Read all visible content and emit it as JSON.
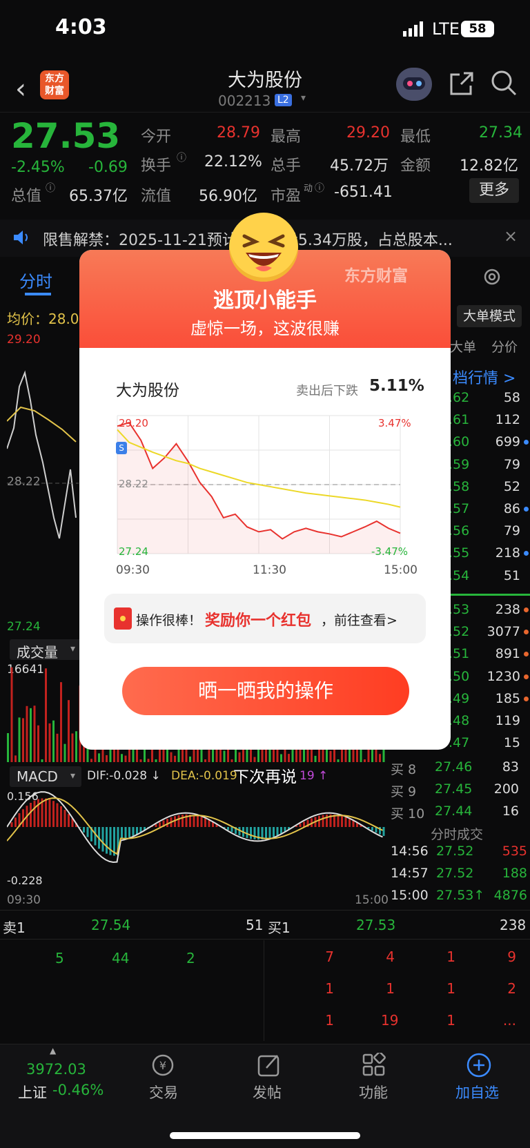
{
  "status_bar": {
    "time": "4:03",
    "network": "LTE",
    "battery": "58"
  },
  "header": {
    "title": "大为股份",
    "code": "002213",
    "level": "L2",
    "logo": "东方\n财富"
  },
  "quote": {
    "price": "27.53",
    "change_pct": "-2.45%",
    "change": "-0.69",
    "labels": {
      "open": "今开",
      "high": "最高",
      "low": "最低",
      "turnover_rate": "换手",
      "volume": "总手",
      "amount": "金额",
      "total_mv": "总值",
      "float_mv": "流值",
      "pe": "市盈"
    },
    "open": "28.79",
    "high": "29.20",
    "low": "27.34",
    "turnover_rate": "22.12%",
    "volume": "45.72万",
    "amount": "12.82亿",
    "total_mv": "65.37亿",
    "float_mv": "56.90亿",
    "pe_sup": "动",
    "pe": "-651.41",
    "more_label": "更多"
  },
  "notice": {
    "text": "限售解禁：2025-11-21预计解禁数量5.34万股，占总股本..."
  },
  "tabs": {
    "active": "分时"
  },
  "background_chart": {
    "avg_label": "均价：28.0",
    "price_high": "29.20",
    "price_mid": "28.22",
    "price_low": "27.24",
    "volume_label": "成交量",
    "volume_max": "16641",
    "macd_label": "MACD",
    "dif": "DIF:-0.028 ↓",
    "dea": "DEA:-0.019",
    "macd_val": "19 ↑",
    "macd_high": "0.156",
    "macd_low": "-0.228",
    "time_start": "09:30",
    "time_end": "15:00",
    "big_order": "大单模式",
    "col_big": "大单",
    "col_price": "分价",
    "level_link": "档行情 >"
  },
  "order_book_right": [
    {
      "price": ".62",
      "vol": "58",
      "dot": ""
    },
    {
      "price": ".61",
      "vol": "112",
      "dot": ""
    },
    {
      "price": ".60",
      "vol": "699",
      "dot": "blue"
    },
    {
      "price": ".59",
      "vol": "79",
      "dot": ""
    },
    {
      "price": ".58",
      "vol": "52",
      "dot": ""
    },
    {
      "price": ".57",
      "vol": "86",
      "dot": "blue"
    },
    {
      "price": ".56",
      "vol": "79",
      "dot": ""
    },
    {
      "price": ".55",
      "vol": "218",
      "dot": "blue"
    },
    {
      "price": ".54",
      "vol": "51",
      "dot": ""
    }
  ],
  "order_book_buy": [
    {
      "price": ".53",
      "vol": "238",
      "dot": "orange"
    },
    {
      "price": ".52",
      "vol": "3077",
      "dot": "orange"
    },
    {
      "price": ".51",
      "vol": "891",
      "dot": "orange"
    },
    {
      "price": ".50",
      "vol": "1230",
      "dot": "orange"
    },
    {
      "price": ".49",
      "vol": "185",
      "dot": "orange"
    },
    {
      "price": ".48",
      "vol": "119",
      "dot": ""
    },
    {
      "price": ".47",
      "vol": "15",
      "dot": ""
    }
  ],
  "order_book_buy_full": [
    {
      "label": "买 8",
      "price": "27.46",
      "vol": "83"
    },
    {
      "label": "买 9",
      "price": "27.45",
      "vol": "200"
    },
    {
      "label": "买 10",
      "price": "27.44",
      "vol": "16"
    }
  ],
  "ticks_title": "分时成交",
  "ticks": [
    {
      "time": "14:56",
      "price": "27.52",
      "vol": "535",
      "color": "red"
    },
    {
      "time": "14:57",
      "price": "27.52",
      "vol": "188",
      "color": "green"
    },
    {
      "time": "15:00",
      "price": "27.53↑",
      "vol": "4876",
      "color": "green"
    }
  ],
  "queue": {
    "sell_label": "卖1",
    "sell_price": "27.54",
    "sell_vol": "51",
    "buy_label": "买1",
    "buy_price": "27.53",
    "buy_vol": "238",
    "sell_rows": [
      [
        "5",
        "44",
        "2"
      ]
    ],
    "buy_rows": [
      [
        "7",
        "4",
        "1",
        "9"
      ],
      [
        "1",
        "1",
        "1",
        "2"
      ],
      [
        "1",
        "19",
        "1",
        "..."
      ]
    ]
  },
  "modal": {
    "brand": "东方财富",
    "title": "逃顶小能手",
    "subtitle": "虚惊一场，这波很赚",
    "stock": "大为股份",
    "drop_label": "卖出后下跌",
    "drop_value": "5.11%",
    "chart_labels": {
      "high": "29.20",
      "high_pct": "3.47%",
      "mid": "28.22",
      "low": "27.24",
      "low_pct": "-3.47%",
      "t0": "09:30",
      "t1": "11:30",
      "t2": "15:00",
      "marker": "S"
    },
    "reward_prefix": "操作很棒！",
    "reward_highlight": "奖励你一个红包",
    "reward_suffix": "，前往查看>",
    "share_button": "晒一晒我的操作",
    "later": "下次再说"
  },
  "chart_data": {
    "type": "line",
    "x": [
      "09:30",
      "09:40",
      "09:50",
      "10:00",
      "10:10",
      "10:20",
      "10:30",
      "10:40",
      "10:50",
      "11:00",
      "11:10",
      "11:20",
      "11:30",
      "13:10",
      "13:20",
      "13:30",
      "13:40",
      "13:50",
      "14:00",
      "14:10",
      "14:20",
      "14:30",
      "14:40",
      "14:50",
      "15:00"
    ],
    "series": [
      {
        "values": [
          29.05,
          29.1,
          28.85,
          28.45,
          28.6,
          28.8,
          28.55,
          28.25,
          28.05,
          27.75,
          27.8,
          27.62,
          27.55,
          27.58,
          27.45,
          27.55,
          27.6,
          27.55,
          27.52,
          27.48,
          27.55,
          27.62,
          27.7,
          27.6,
          27.53
        ]
      },
      {
        "values": [
          29.0,
          28.82,
          28.75,
          28.68,
          28.62,
          28.56,
          28.52,
          28.45,
          28.4,
          28.35,
          28.3,
          28.25,
          28.22,
          28.19,
          28.16,
          28.13,
          28.1,
          28.08,
          28.06,
          28.04,
          28.02,
          28.0,
          27.97,
          27.94,
          27.9
        ]
      }
    ],
    "ylim": [
      27.24,
      29.2
    ],
    "reference": 28.22,
    "colors": {
      "price": "#e8322e",
      "avg": "#ecd827",
      "reference": "#888888"
    }
  },
  "bottom_bar": {
    "index_value": "3972.03",
    "index_name": "上证",
    "index_change": "-0.46%",
    "items": [
      {
        "label": "交易"
      },
      {
        "label": "发帖"
      },
      {
        "label": "功能"
      },
      {
        "label": "加自选"
      }
    ]
  },
  "colors": {
    "up": "#e8322e",
    "down": "#27b53b",
    "accent": "#3b8bff"
  }
}
